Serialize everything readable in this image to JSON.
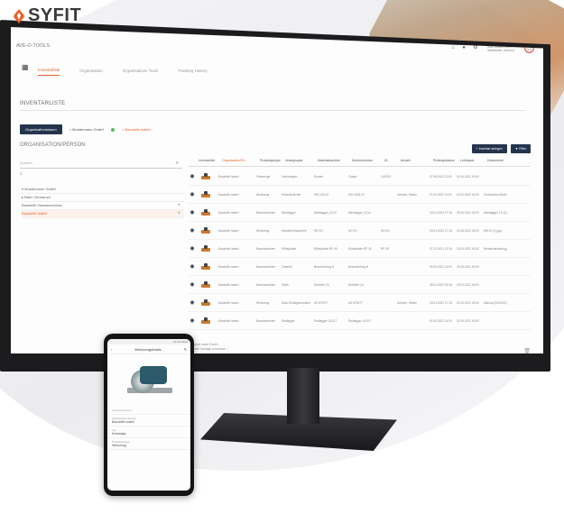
{
  "brand": {
    "name": "SYFIT",
    "accent": "#e8632a"
  },
  "app": {
    "page_name": "AVE-O-TOOLS",
    "user": {
      "name": "Max Mustermann",
      "role": "Mitarbeiter (Admin)"
    },
    "tabs": [
      {
        "label": "Inventarliste",
        "active": true
      },
      {
        "label": "Organisation",
        "active": false
      },
      {
        "label": "Organisations Tools",
        "active": false
      },
      {
        "label": "Tracking History",
        "active": false
      }
    ],
    "section_title": "INVENTARLISTE",
    "subbar": {
      "org_button": "Organisationsbaum",
      "crumb_1": "> Mustermann GmbH",
      "crumb_2": "> Baustelle Isabel"
    },
    "left": {
      "title": "ORGANISATION/PERSON",
      "search_placeholder": "Suchen",
      "tree": [
        {
          "label": "▾ Mustermann GmbH",
          "selected": false,
          "plus": false
        },
        {
          "label": "▸ Bahn Verbrauch",
          "selected": false,
          "plus": false
        },
        {
          "label": "Baustelle Hausanschluss",
          "selected": false,
          "plus": true
        },
        {
          "label": "Baustelle Isabel",
          "selected": true,
          "plus": true
        }
      ]
    },
    "actions": {
      "add": "+ Inventar anlegen",
      "filter": "▼ Filter"
    },
    "table": {
      "headers": [
        "Inventarbild",
        "Organisation/Pe...",
        "Produktgruppe",
        "Untergruppe",
        "Materialnummer",
        "Seriennummer",
        "ID",
        "Anzahl",
        "Prüfungsdatum",
        "Leihdauer",
        "Dokumente"
      ],
      "rows": [
        {
          "org": "Baustelle Isabel",
          "group": "Fahrzeuge",
          "sub": "Lieferwagen",
          "mat": "Ducato",
          "serial": "Zusatz",
          "id": "10/2021",
          "qty": "",
          "date": "07.06.2022 12:00",
          "loan": "01.08.2021 00:00",
          "docs": ""
        },
        {
          "org": "Baustelle Isabel",
          "group": "Werkzeug",
          "sub": "Winkelschleifer",
          "mat": "WS 125-23",
          "serial": "WS 4325-23",
          "id": "",
          "qty": "Uebrich, Stefan",
          "date": "27.02.2022 11:00",
          "loan": "02.02.2022 00:00",
          "docs": "Technisches Blatt.pdf"
        },
        {
          "org": "Baustelle Isabel",
          "group": "Baumaschinen",
          "sub": "Minibagger",
          "mat": "Minibagger_2014",
          "serial": "Minibagger_2014",
          "id": "",
          "qty": "",
          "date": "16.01.2022 17:18",
          "loan": "30.06.2021 00:00",
          "docs": "Minibagger 1.6 (1).jpg"
        },
        {
          "org": "Baustelle Isabel",
          "group": "Werkzeug",
          "sub": "Handbohrmaschine",
          "mat": "HD 9/1",
          "serial": "HD 9/1",
          "id": "HD 9/1",
          "qty": "",
          "date": "09.01.2022 17:18",
          "loan": "12.08.2021 00:00",
          "docs": "WH-91 (1).jpg"
        },
        {
          "org": "Baustelle Isabel",
          "group": "Baumaschinen",
          "sub": "Rüttelplatte",
          "mat": "Rüttelplatte RP-30",
          "serial": "Rüttelplatte RP-30",
          "id": "RP-30",
          "qty": "",
          "date": "07.12.2021 12:18",
          "loan": "20.09.2021 00:00",
          "docs": "Betriebsanleitung.pdf"
        },
        {
          "org": "Baustelle Isabel",
          "group": "Baumaschinen",
          "sub": "Zubehör",
          "mat": "Beschichtung B",
          "serial": "Beschichtung B",
          "id": "",
          "qty": "",
          "date": "05.05.2022 12:00",
          "loan": "25.05.2021 00:00",
          "docs": ""
        },
        {
          "org": "Baustelle Isabel",
          "group": "Baumaschinen",
          "sub": "Stativ",
          "mat": "Nivelliert 2d",
          "serial": "Nivelliert 2d",
          "id": "",
          "qty": "",
          "date": "28.04.2022 09:18",
          "loan": "15.03.2021 00:00",
          "docs": ""
        },
        {
          "org": "Baustelle Isabel",
          "group": "Werkzeug",
          "sub": "Akku-Schlagschrauber",
          "mat": "AS 670077",
          "serial": "AS 670077",
          "id": "",
          "qty": "Uebrich, Stefan",
          "date": "16.01.2022 17:18",
          "loan": "01.03.2021 00:00",
          "docs": "Manual (2021002).pdf"
        },
        {
          "org": "Baustelle Isabel",
          "group": "Baumaschinen",
          "sub": "Radlagger",
          "mat": "Radlagger 1410-7",
          "serial": "Radlagger 1410-7",
          "id": "",
          "qty": "",
          "date": "01.05.2022 14:00",
          "loan": "21.05.2021 00:00",
          "docs": ""
        }
      ],
      "footer_1": "Export nach Excel ↓",
      "footer_2": "Email Vorlage Inventare ↓"
    }
  },
  "phone": {
    "status": "10:40 100%",
    "header_title": "Werkzeugdetails",
    "fields": [
      {
        "label": "Inventarnummer",
        "value": ""
      },
      {
        "label": "Organisation/Person",
        "value": "Baustelle Isabel"
      },
      {
        "label": "Typ",
        "value": "Kreissäge"
      },
      {
        "label": "Produktgruppe",
        "value": "Werkzeug"
      }
    ]
  }
}
